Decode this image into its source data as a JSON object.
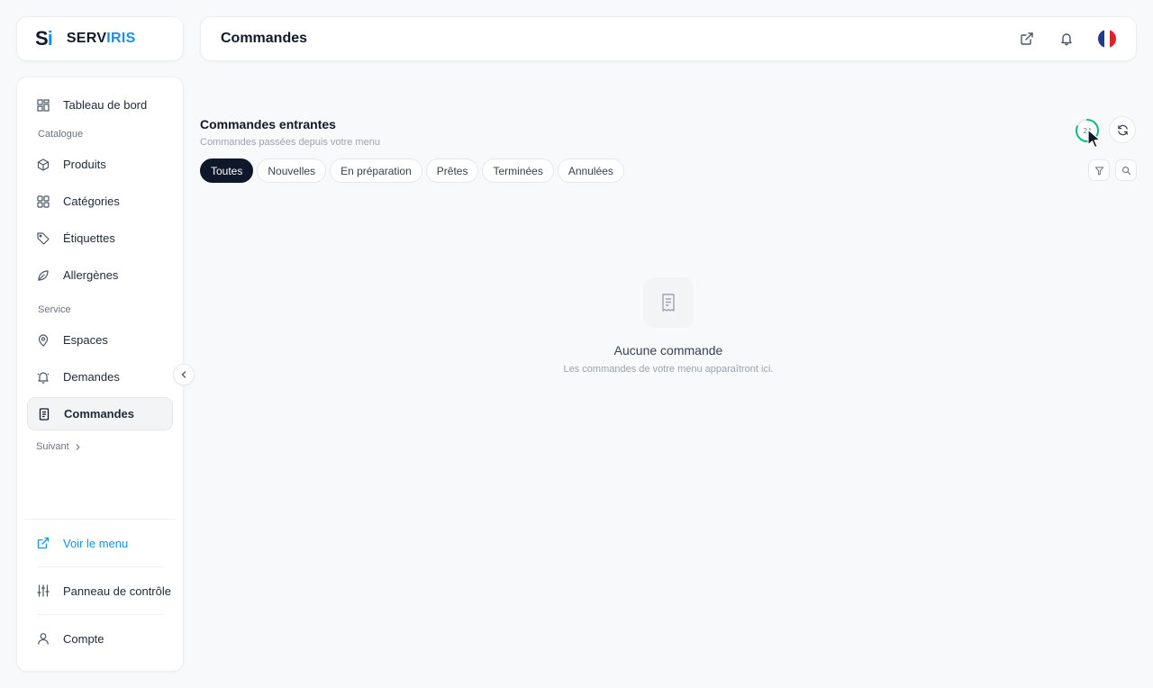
{
  "brand": {
    "mark_s": "S",
    "mark_i": "i",
    "name_part1": "SERV",
    "name_part2": "IRIS",
    "accent_color": "#1a90e0"
  },
  "header": {
    "title": "Commandes",
    "icons": [
      "external-link-icon",
      "bell-icon",
      "french-flag"
    ]
  },
  "sidebar": {
    "items": [
      {
        "label": "Tableau de bord",
        "icon": "dashboard-icon"
      },
      {
        "section": "Catalogue"
      },
      {
        "label": "Produits",
        "icon": "box-icon"
      },
      {
        "label": "Catégories",
        "icon": "grid-icon"
      },
      {
        "label": "Étiquettes",
        "icon": "tag-icon"
      },
      {
        "label": "Allergènes",
        "icon": "leaf-icon"
      },
      {
        "section": "Service"
      },
      {
        "label": "Espaces",
        "icon": "location-icon"
      },
      {
        "label": "Demandes",
        "icon": "bell-icon"
      },
      {
        "label": "Commandes",
        "icon": "receipt-icon",
        "active": true
      }
    ],
    "section_catalogue": "Catalogue",
    "section_service": "Service",
    "labels": {
      "dashboard": "Tableau de bord",
      "produits": "Produits",
      "categories": "Catégories",
      "etiquettes": "Étiquettes",
      "allergenes": "Allergènes",
      "espaces": "Espaces",
      "demandes": "Demandes",
      "commandes": "Commandes"
    },
    "suivant": "Suivant",
    "bottom": {
      "voir_menu": "Voir le menu",
      "panneau": "Panneau de contrôle",
      "compte": "Compte"
    }
  },
  "main": {
    "title": "Commandes entrantes",
    "subtitle": "Commandes passées depuis votre menu",
    "tabs": [
      "Toutes",
      "Nouvelles",
      "En préparation",
      "Prêtes",
      "Terminées",
      "Annulées"
    ],
    "active_tab": "Toutes",
    "refresh_countdown": "24",
    "empty_title": "Aucune commande",
    "empty_description": "Les commandes de votre menu apparaîtront ici."
  }
}
